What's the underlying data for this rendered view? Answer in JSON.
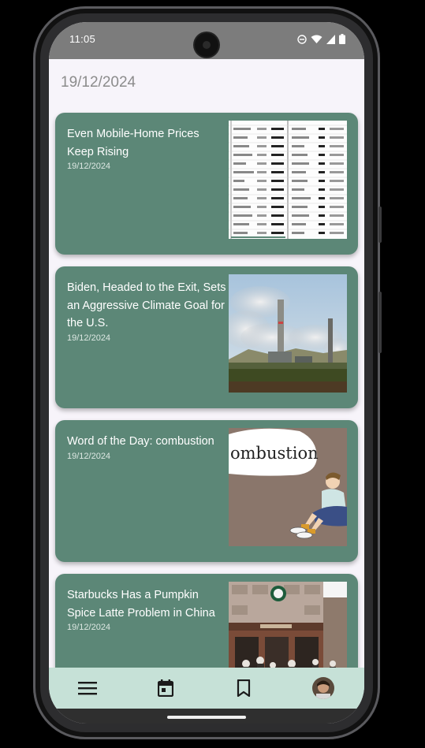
{
  "status_bar": {
    "time": "11:05",
    "icons": [
      "do-not-disturb-icon",
      "wifi-icon",
      "signal-icon",
      "battery-icon"
    ]
  },
  "header": {
    "date": "19/12/2024"
  },
  "articles": [
    {
      "title": "Even Mobile-Home Prices Keep Rising",
      "date": "19/12/2024",
      "image": "price-table-image"
    },
    {
      "title": "Biden, Headed to the Exit, Sets an Aggressive Climate Goal for the U.S.",
      "date": "19/12/2024",
      "image": "smokestack-image"
    },
    {
      "title": "Word of the Day: combustion",
      "date": "19/12/2024",
      "image": "word-of-day-image",
      "image_text": "ombustion"
    },
    {
      "title": "Starbucks Has a Pumpkin Spice Latte Problem in China",
      "date": "19/12/2024",
      "image": "storefront-image"
    }
  ],
  "nav": {
    "items": [
      "menu-icon",
      "calendar-icon",
      "bookmark-icon",
      "profile-avatar"
    ]
  },
  "colors": {
    "card": "#5c8777",
    "nav": "#c6e1d7",
    "status_bar": "#7c7c7c",
    "background": "#f7f4fa"
  }
}
